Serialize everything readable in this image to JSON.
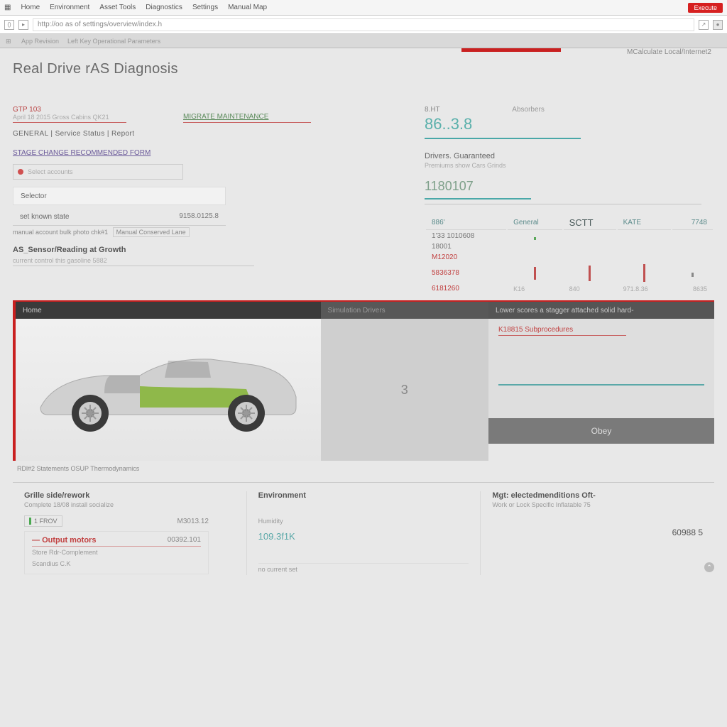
{
  "menubar": {
    "items": [
      "Home",
      "Environment",
      "Asset Tools",
      "Diagnostics",
      "Settings",
      "Manual Map"
    ],
    "close": "Execute"
  },
  "urlbar": {
    "value": "http://oo as of settings/overview/index.h"
  },
  "tabstrip": {
    "items": [
      "App Revision",
      "Left Key Operational Parameters"
    ]
  },
  "page_title": "Real Drive rAS Diagnosis",
  "top_link": "MCalculate Local/Internet2",
  "left": {
    "chip1": "GTP 103",
    "chip1_sub": "April 18 2015 Gross Cabins QK21",
    "chip2": "MIGRATE MAINTENANCE",
    "crumb": "GENERAL  |  Service Status  |  Report",
    "link": "STAGE CHANGE RECOMMENDED FORM",
    "browse": "Select accounts",
    "tbl": {
      "k1": "Selector",
      "k2": "set known state",
      "v2": "9158.0125.8"
    },
    "long": {
      "a": "manual account bulk photo chk#1",
      "b": "Manual Conserved Lane"
    },
    "sec": "AS_Sensor/Reading at Growth",
    "sec_sub": "current control this gasoline 5882"
  },
  "right": {
    "big_label": "8.HT",
    "big_value": "86..3.8",
    "big_sub": "Absorbers",
    "group_title": "Drivers. Guaranteed",
    "group_sub": "Premiums show Cars Grinds",
    "group_val": "1180107",
    "table": {
      "headers": [
        "886'",
        "General",
        "SCTT",
        "KATE",
        "7748"
      ],
      "rows": [
        {
          "c0": "1'33 1010608"
        },
        {
          "c0": "18001"
        },
        {
          "c0": "M12020"
        },
        {
          "c0": "5836378"
        },
        {
          "c0": "6181260",
          "x1": "K16",
          "x2": "840",
          "x3": "971.8.36",
          "x4": "8635"
        }
      ]
    }
  },
  "panels": {
    "p1_title": "Home",
    "p2_title": "Simulation Drivers",
    "p2_body": "3",
    "p3_title": "Lower scores a stagger attached solid hard-",
    "p3_red": "K18815 Subprocedures",
    "p3_btn": "Obey"
  },
  "caption": "RDl#2  Statements  OSUP  Thermodynamics",
  "cards": {
    "c1": {
      "title": "Grille side/rework",
      "sub": "Complete 18/08 install socialize",
      "tag": "1 FROV",
      "tag_v": "M3013.12",
      "hl": "Output motors",
      "hl_v": "00392.101",
      "r1": "Store Rdr-Complement",
      "r2": "Scandius C.K"
    },
    "c2": {
      "title": "Environment",
      "r1": "Humidity",
      "r1_v": "109.3f1K"
    },
    "c3": {
      "title": "Mgt: electedmenditions Oft-",
      "sub": "Work or Lock Specific Inflatable  75",
      "r1": "60988  5"
    }
  },
  "chart_data": {
    "type": "bar",
    "categories": [
      "K16",
      "840",
      "971",
      "8635"
    ],
    "series": [
      {
        "name": "sparkline",
        "values": [
          18,
          22,
          25,
          6
        ]
      }
    ],
    "xlabel": "",
    "ylabel": "",
    "title": ""
  }
}
